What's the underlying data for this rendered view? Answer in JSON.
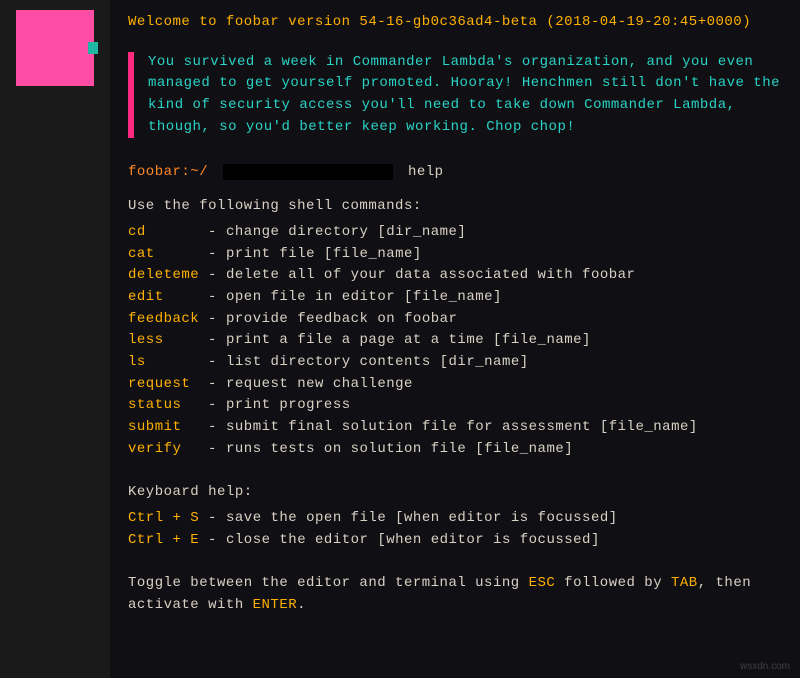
{
  "welcome": "Welcome to foobar version 54-16-gb0c36ad4-beta (2018-04-19-20:45+0000)",
  "message": "You survived a week in Commander Lambda's organization, and you even managed to get yourself promoted. Hooray! Henchmen still don't have the kind of security access you'll need to take down Commander Lambda, though, so you'd better keep working. Chop chop!",
  "prompt": {
    "host": "foobar:~/",
    "typed": "help"
  },
  "help_intro": "Use the following shell commands:",
  "commands": [
    {
      "name": "cd",
      "desc": "change directory [dir_name]"
    },
    {
      "name": "cat",
      "desc": "print file [file_name]"
    },
    {
      "name": "deleteme",
      "desc": "delete all of your data associated with foobar"
    },
    {
      "name": "edit",
      "desc": "open file in editor [file_name]"
    },
    {
      "name": "feedback",
      "desc": "provide feedback on foobar"
    },
    {
      "name": "less",
      "desc": "print a file a page at a time [file_name]"
    },
    {
      "name": "ls",
      "desc": "list directory contents [dir_name]"
    },
    {
      "name": "request",
      "desc": "request new challenge"
    },
    {
      "name": "status",
      "desc": "print progress"
    },
    {
      "name": "submit",
      "desc": "submit final solution file for assessment [file_name]"
    },
    {
      "name": "verify",
      "desc": "runs tests on solution file [file_name]"
    }
  ],
  "kb_title": "Keyboard help:",
  "kb": [
    {
      "combo": "Ctrl + S",
      "desc": "save the open file [when editor is focussed]"
    },
    {
      "combo": "Ctrl + E",
      "desc": "close the editor [when editor is focussed]"
    }
  ],
  "footer": {
    "p1": "Toggle between the editor and terminal using ",
    "k1": "ESC",
    "p2": " followed by ",
    "k2": "TAB",
    "p3": ", then activate with ",
    "k3": "ENTER",
    "p4": "."
  },
  "watermark": "wsxdn.com"
}
